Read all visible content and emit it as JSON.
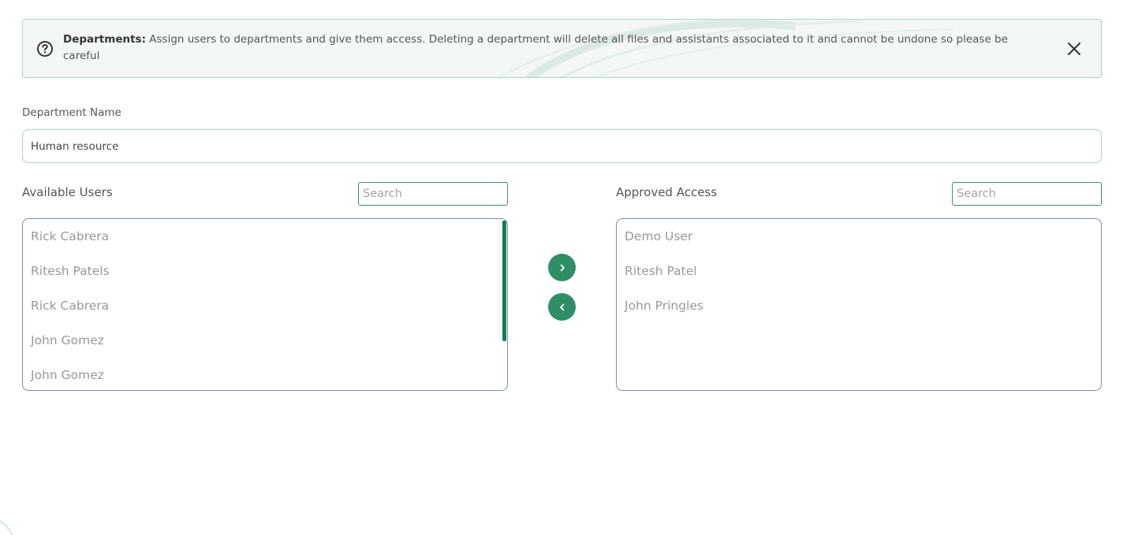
{
  "banner": {
    "title": "Departments:",
    "message": "Assign users to departments and give them access. Deleting a department will delete all files and assistants associated to it and cannot be undone so please be careful",
    "info_icon": "help-circle-icon",
    "close_icon": "close-icon"
  },
  "department": {
    "label": "Department Name",
    "value": "Human resource"
  },
  "available": {
    "title": "Available Users",
    "search_placeholder": "Search",
    "users": [
      "Rick Cabrera",
      "Ritesh Patels",
      "Rick Cabrera",
      "John Gomez",
      "John Gomez"
    ]
  },
  "approved": {
    "title": "Approved Access",
    "search_placeholder": "Search",
    "users": [
      "Demo User",
      "Ritesh Patel",
      "John Pringles"
    ]
  },
  "transfer": {
    "add_icon": "chevron-right-icon",
    "remove_icon": "chevron-left-icon"
  },
  "colors": {
    "accent": "#2f8d67",
    "scrollbar": "#147a58",
    "banner_border": "#a8d5c2",
    "banner_bg": "#f3f7f6"
  }
}
